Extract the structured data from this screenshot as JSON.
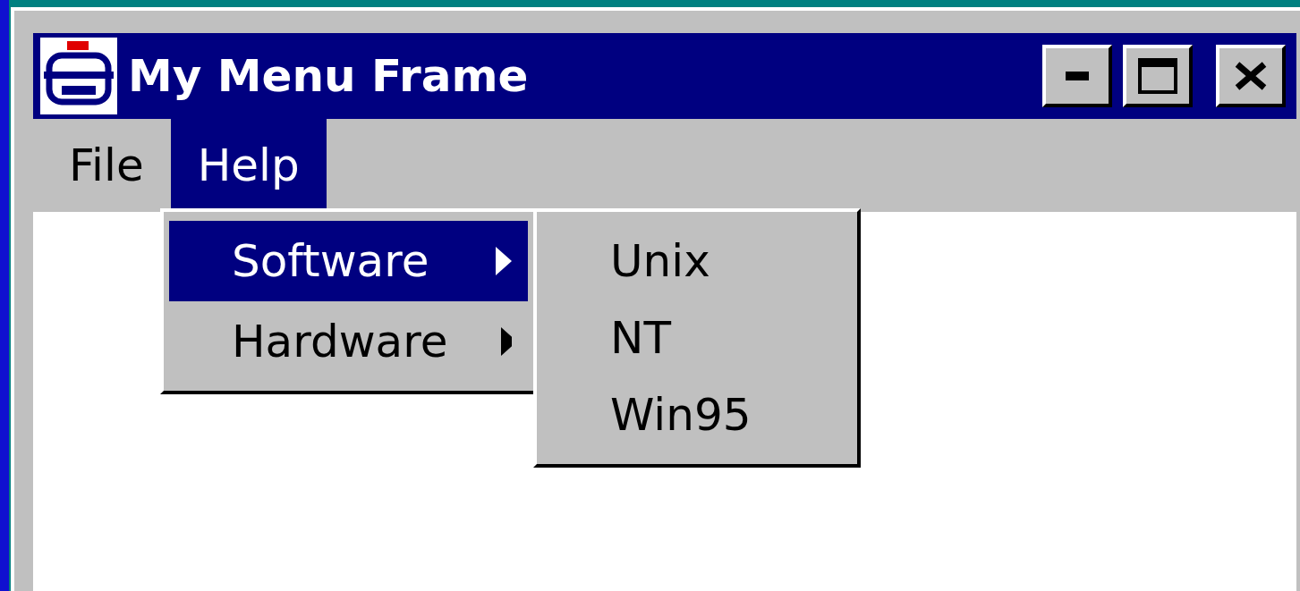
{
  "window": {
    "title": "My Menu Frame"
  },
  "menu_bar": [
    {
      "label": "File",
      "selected": false
    },
    {
      "label": "Help",
      "selected": true
    }
  ],
  "menu": [
    {
      "label": "Software",
      "selected": true,
      "submenu": true
    },
    {
      "label": "Hardware",
      "selected": false,
      "submenu": true
    }
  ],
  "submenu": [
    {
      "label": "Unix",
      "selected": false
    },
    {
      "label": "NT",
      "selected": false
    },
    {
      "label": "Win95",
      "selected": false
    }
  ]
}
